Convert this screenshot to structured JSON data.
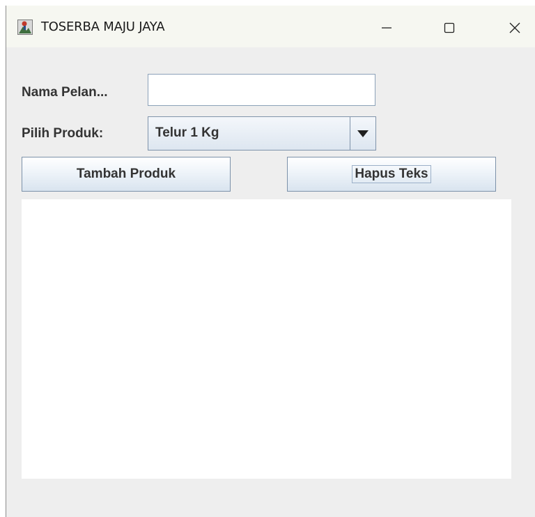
{
  "window": {
    "title": "TOSERBA MAJU JAYA",
    "controls": {
      "minimize": "minimize-icon",
      "maximize": "maximize-icon",
      "close": "close-icon"
    }
  },
  "form": {
    "customer_label": "Nama Pelan...",
    "customer_value": "",
    "product_label": "Pilih Produk:",
    "product_selected": "Telur 1 Kg"
  },
  "buttons": {
    "add_label": "Tambah Produk",
    "clear_label": "Hapus Teks"
  },
  "output": {
    "text": ""
  },
  "colors": {
    "window_bg": "#eeeeee",
    "titlebar_bg": "#f6f7f1",
    "button_border": "#7c91a9",
    "text": "#333333"
  }
}
